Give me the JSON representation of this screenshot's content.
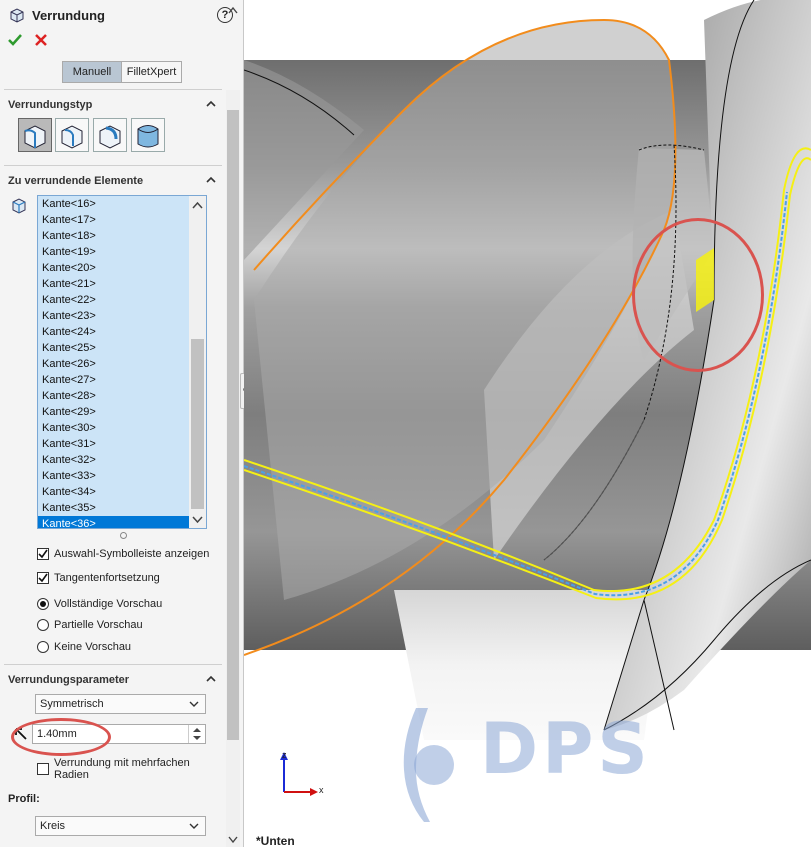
{
  "panel": {
    "title": "Verrundung",
    "help_label": "?",
    "tabs": [
      {
        "label": "Manuell",
        "active": true
      },
      {
        "label": "FilletXpert",
        "active": false
      }
    ]
  },
  "fillet_type": {
    "header": "Verrundungstyp",
    "buttons": [
      {
        "name": "constant-size-fillet",
        "selected": true
      },
      {
        "name": "variable-size-fillet",
        "selected": false
      },
      {
        "name": "face-fillet",
        "selected": false
      },
      {
        "name": "full-round-fillet",
        "selected": false
      }
    ]
  },
  "items_to_fillet": {
    "header": "Zu verrundende Elemente",
    "edges": [
      "Kante<16>",
      "Kante<17>",
      "Kante<18>",
      "Kante<19>",
      "Kante<20>",
      "Kante<21>",
      "Kante<22>",
      "Kante<23>",
      "Kante<24>",
      "Kante<25>",
      "Kante<26>",
      "Kante<27>",
      "Kante<28>",
      "Kante<29>",
      "Kante<30>",
      "Kante<31>",
      "Kante<32>",
      "Kante<33>",
      "Kante<34>",
      "Kante<35>",
      "Kante<36>"
    ],
    "selected_edge": "Kante<36>",
    "options": [
      {
        "label": "Auswahl-Symbolleiste anzeigen",
        "checked": true
      },
      {
        "label": "Tangentenfortsetzung",
        "checked": true
      }
    ],
    "preview": [
      {
        "label": "Vollständige Vorschau",
        "selected": true
      },
      {
        "label": "Partielle Vorschau",
        "selected": false
      },
      {
        "label": "Keine Vorschau",
        "selected": false
      }
    ]
  },
  "fillet_params": {
    "header": "Verrundungsparameter",
    "method": "Symmetrisch",
    "radius": "1.40mm",
    "multi_radius_label": "Verrundung mit mehrfachen Radien",
    "multi_radius_checked": false,
    "profile_label": "Profil:",
    "profile": "Kreis"
  },
  "viewport": {
    "view_label": "*Unten",
    "watermark": "DPS",
    "triad": {
      "z": "z",
      "x": "x"
    }
  },
  "colors": {
    "accent_selection": "#0078d7",
    "list_bg": "#cce4f7",
    "annotation_ring": "#d9534f",
    "preview_yellow": "#f5f014",
    "preview_blue": "#4aa0e8",
    "edge_orange": "#f28c1c"
  }
}
